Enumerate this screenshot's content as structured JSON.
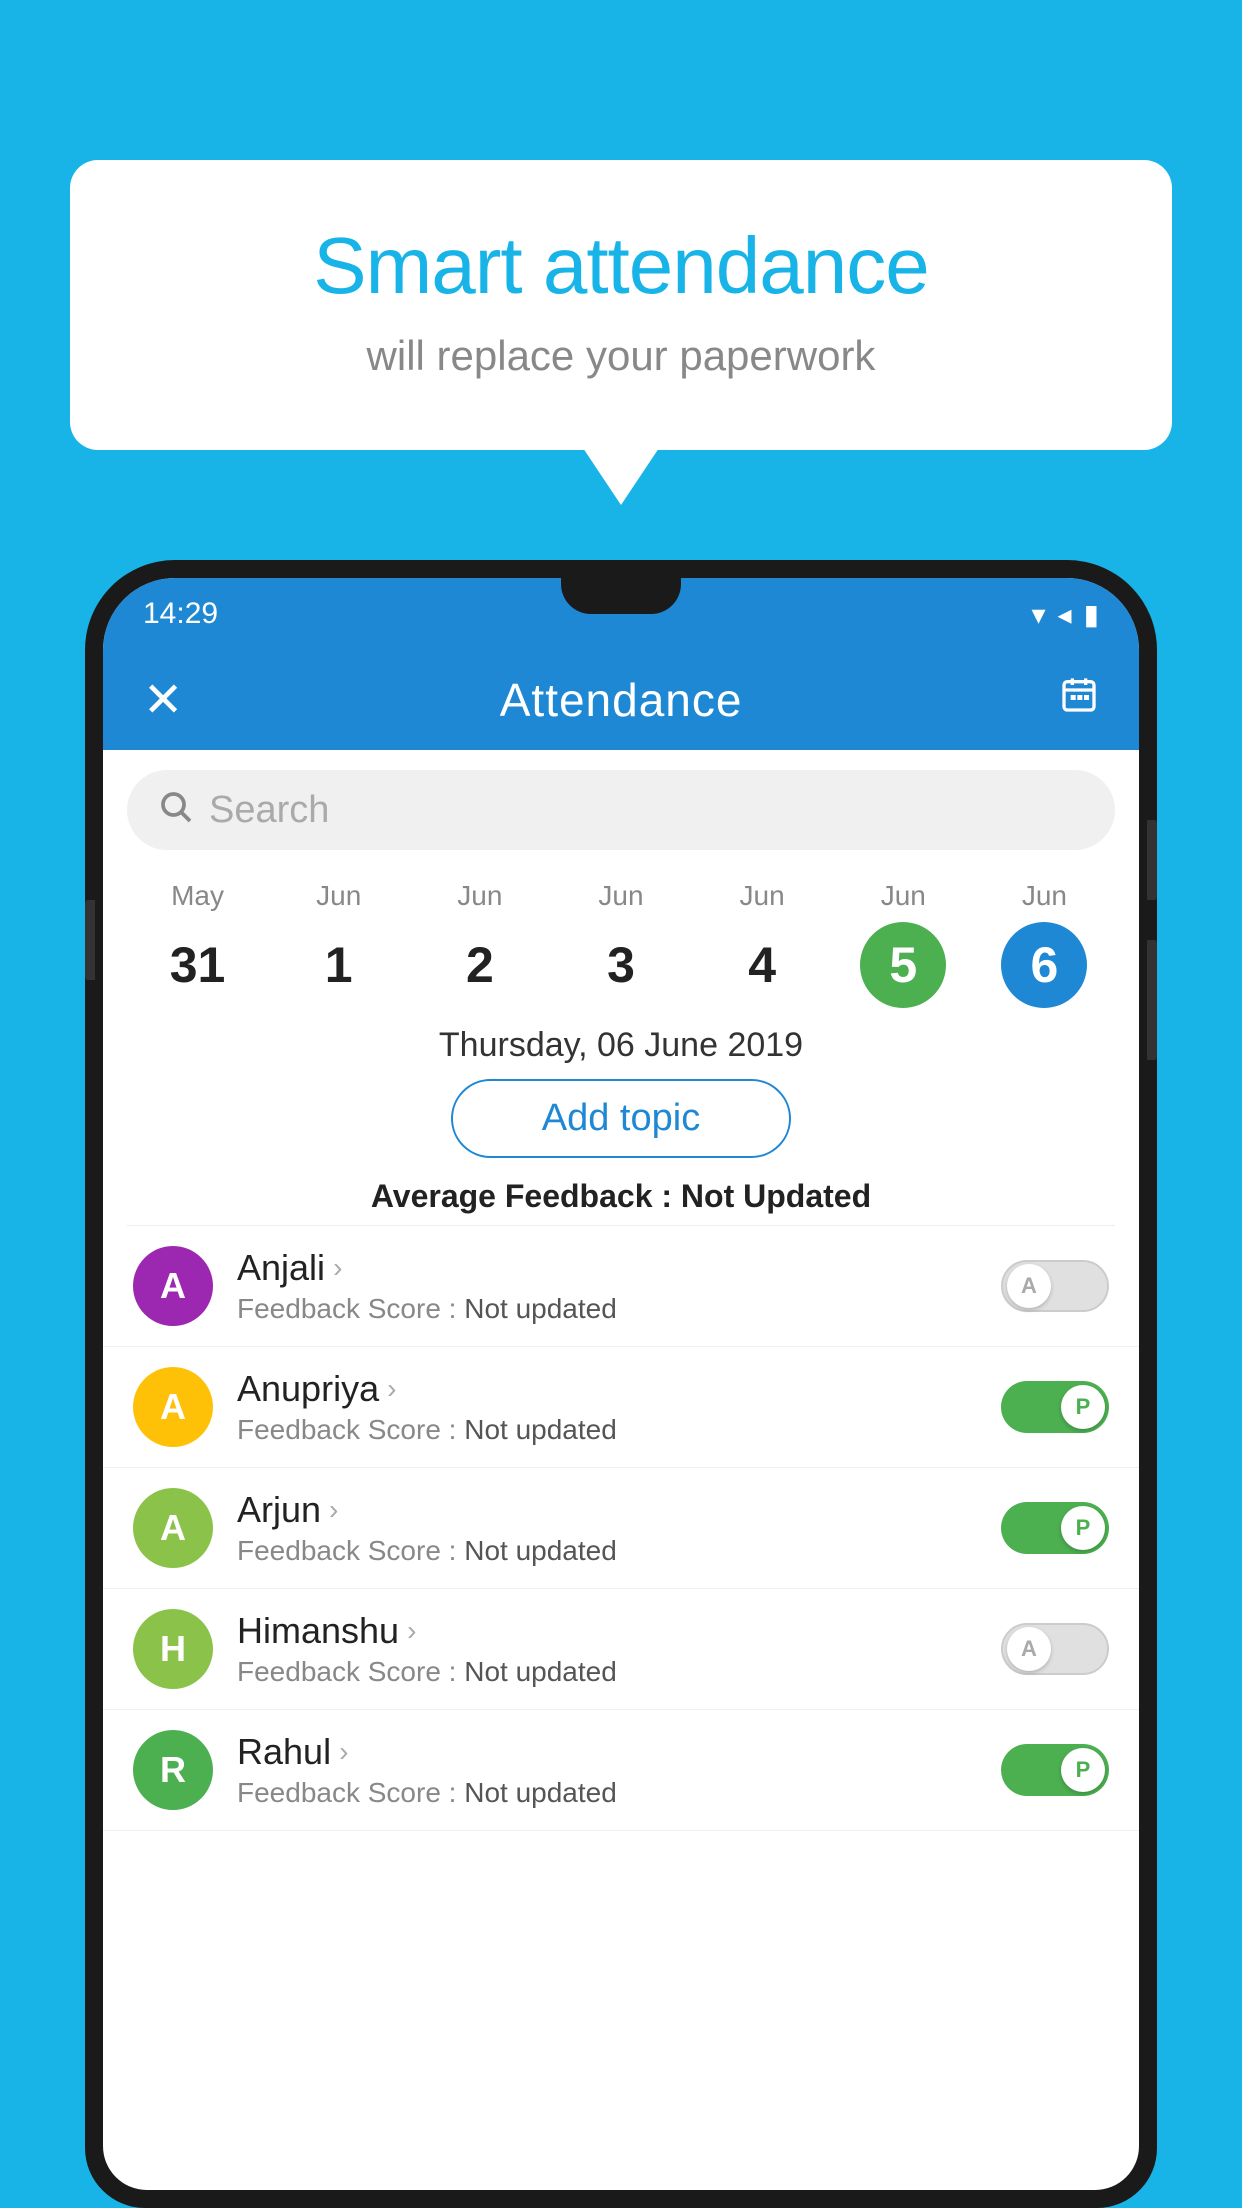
{
  "background_color": "#18b4e8",
  "bubble": {
    "title": "Smart attendance",
    "subtitle": "will replace your paperwork"
  },
  "status_bar": {
    "time": "14:29",
    "icons": [
      "▼",
      "◄",
      "▮"
    ]
  },
  "app_header": {
    "close_label": "✕",
    "title": "Attendance",
    "calendar_icon": "📅"
  },
  "search": {
    "placeholder": "Search"
  },
  "calendar": {
    "days": [
      {
        "month": "May",
        "date": "31",
        "state": "normal"
      },
      {
        "month": "Jun",
        "date": "1",
        "state": "normal"
      },
      {
        "month": "Jun",
        "date": "2",
        "state": "normal"
      },
      {
        "month": "Jun",
        "date": "3",
        "state": "normal"
      },
      {
        "month": "Jun",
        "date": "4",
        "state": "normal"
      },
      {
        "month": "Jun",
        "date": "5",
        "state": "today"
      },
      {
        "month": "Jun",
        "date": "6",
        "state": "selected"
      }
    ],
    "selected_date_label": "Thursday, 06 June 2019"
  },
  "add_topic_label": "Add topic",
  "avg_feedback": {
    "label": "Average Feedback :",
    "value": "Not Updated"
  },
  "students": [
    {
      "name": "Anjali",
      "avatar_letter": "A",
      "avatar_color": "#9c27b0",
      "feedback_label": "Feedback Score :",
      "feedback_value": "Not updated",
      "toggle_state": "off",
      "toggle_letter": "A"
    },
    {
      "name": "Anupriya",
      "avatar_letter": "A",
      "avatar_color": "#ffc107",
      "feedback_label": "Feedback Score :",
      "feedback_value": "Not updated",
      "toggle_state": "on",
      "toggle_letter": "P"
    },
    {
      "name": "Arjun",
      "avatar_letter": "A",
      "avatar_color": "#8bc34a",
      "feedback_label": "Feedback Score :",
      "feedback_value": "Not updated",
      "toggle_state": "on",
      "toggle_letter": "P"
    },
    {
      "name": "Himanshu",
      "avatar_letter": "H",
      "avatar_color": "#8bc34a",
      "feedback_label": "Feedback Score :",
      "feedback_value": "Not updated",
      "toggle_state": "off",
      "toggle_letter": "A"
    },
    {
      "name": "Rahul",
      "avatar_letter": "R",
      "avatar_color": "#4caf50",
      "feedback_label": "Feedback Score :",
      "feedback_value": "Not updated",
      "toggle_state": "on",
      "toggle_letter": "P"
    }
  ]
}
